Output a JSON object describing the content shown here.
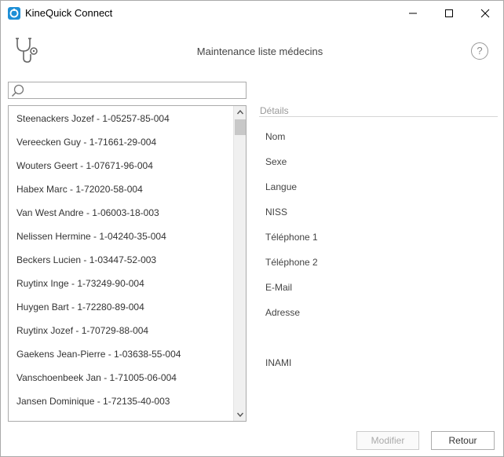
{
  "window": {
    "title": "KineQuick Connect",
    "accent_color": "#1e8fd6"
  },
  "header": {
    "title": "Maintenance liste médecins",
    "logo_icon": "stethoscope-icon",
    "help_label": "?"
  },
  "search": {
    "value": "",
    "placeholder": "",
    "icon": "search-icon"
  },
  "doctors": [
    "Steenackers Jozef - 1-05257-85-004",
    "Vereecken Guy - 1-71661-29-004",
    "Wouters Geert - 1-07671-96-004",
    "Habex Marc - 1-72020-58-004",
    "Van West Andre - 1-06003-18-003",
    "Nelissen Hermine - 1-04240-35-004",
    "Beckers Lucien - 1-03447-52-003",
    "Ruytinx Inge - 1-73249-90-004",
    "Huygen Bart - 1-72280-89-004",
    "Ruytinx Jozef - 1-70729-88-004",
    "Gaekens Jean-Pierre - 1-03638-55-004",
    "Vanschoenbeek Jan - 1-71005-06-004",
    "Jansen Dominique - 1-72135-40-003"
  ],
  "details": {
    "header": "Détails",
    "fields": {
      "nom": "Nom",
      "sexe": "Sexe",
      "langue": "Langue",
      "niss": "NISS",
      "telephone1": "Téléphone 1",
      "telephone2": "Téléphone 2",
      "email": "E-Mail",
      "adresse": "Adresse",
      "inami": "INAMI"
    }
  },
  "buttons": {
    "modifier": "Modifier",
    "retour": "Retour"
  }
}
